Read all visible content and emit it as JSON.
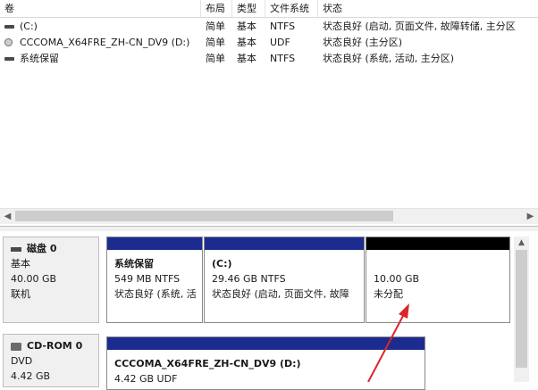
{
  "volume_list": {
    "columns": [
      "卷",
      "布局",
      "类型",
      "文件系统",
      "状态"
    ],
    "rows": [
      {
        "icon": "drive-icon",
        "name": "(C:)",
        "layout": "简单",
        "type": "基本",
        "fs": "NTFS",
        "status": "状态良好 (启动, 页面文件, 故障转储, 主分区"
      },
      {
        "icon": "dvd-drive-icon",
        "name": "CCCOMA_X64FRE_ZH-CN_DV9 (D:)",
        "layout": "简单",
        "type": "基本",
        "fs": "UDF",
        "status": "状态良好 (主分区)"
      },
      {
        "icon": "drive-icon",
        "name": "系统保留",
        "layout": "简单",
        "type": "基本",
        "fs": "NTFS",
        "status": "状态良好 (系统, 活动, 主分区)"
      }
    ]
  },
  "disks": [
    {
      "name": "磁盘 0",
      "kind": "基本",
      "size": "40.00 GB",
      "state": "联机",
      "partitions": [
        {
          "title": "系统保留",
          "detail": "549 MB NTFS",
          "status": "状态良好 (系统, 活",
          "band_color": "#1c2b8f"
        },
        {
          "title": "(C:)",
          "detail": "29.46 GB NTFS",
          "status": "状态良好 (启动, 页面文件, 故障",
          "band_color": "#1c2b8f"
        },
        {
          "title": "",
          "detail": "10.00 GB",
          "status": "未分配",
          "band_color": "#000000"
        }
      ]
    },
    {
      "name": "CD-ROM 0",
      "kind": "DVD",
      "size": "4.42 GB",
      "partitions": [
        {
          "title": "CCCOMA_X64FRE_ZH-CN_DV9  (D:)",
          "detail": "4.42 GB UDF",
          "band_color": "#1c2b8f"
        }
      ]
    }
  ],
  "annotation": {
    "arrow_color": "#d9262c"
  }
}
